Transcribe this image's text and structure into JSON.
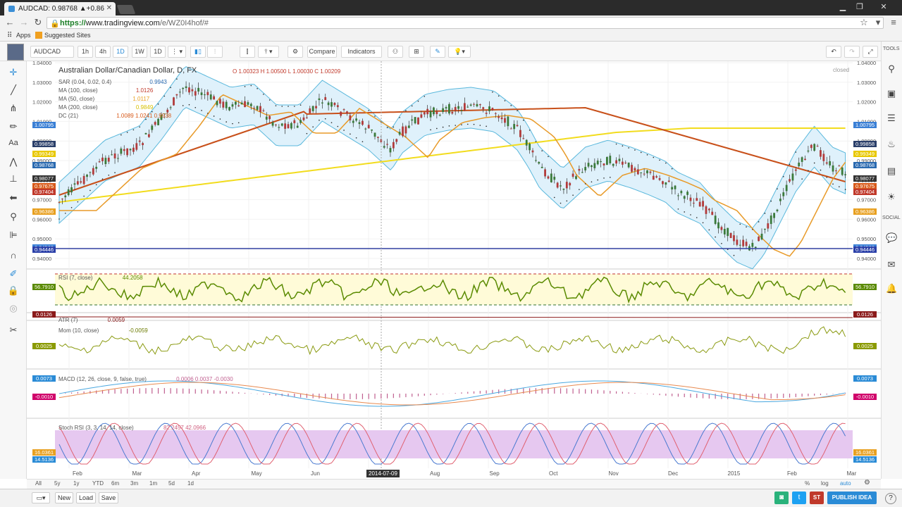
{
  "browser": {
    "tab_title": "AUDCAD: 0.98768 ▲+0.86",
    "url_prefix": "https://",
    "url_host": "www.tradingview.com",
    "url_path": "/e/WZ0I4hof/#",
    "bookmarks": [
      "Apps",
      "Suggested Sites"
    ]
  },
  "header": {
    "symbol": "AUDCAD",
    "intervals": [
      "1h",
      "4h",
      "1D",
      "1W",
      "1D"
    ],
    "compare_label": "Compare",
    "indicators_label": "Indicators"
  },
  "chart": {
    "title": "Australian Dollar/Canadian Dollar, D, FX",
    "ohlc": "O 1.00323 H 1.00500 L 1.00030 C 1.00209",
    "status": "closed",
    "studies": [
      {
        "name": "SAR (0.04, 0.02, 0.4)",
        "value": "0.9943"
      },
      {
        "name": "MA (100, close)",
        "value": "1.0126"
      },
      {
        "name": "MA (50, close)",
        "value": "1.0117"
      },
      {
        "name": "MA (200, close)",
        "value": "0.9849"
      },
      {
        "name": "DC (21)",
        "value": "1.0089  1.0241  0.9938"
      }
    ],
    "price_axis": [
      "1.04000",
      "1.03000",
      "1.02000",
      "1.01000",
      "1.00000",
      "0.99000",
      "0.98000",
      "0.97000",
      "0.96000",
      "0.95000",
      "0.94000"
    ],
    "price_tags": [
      {
        "value": "1.00795",
        "color": "#3a7fd5"
      },
      {
        "value": "0.99858",
        "color": "#2a3f6a"
      },
      {
        "value": "0.99349",
        "color": "#e8c800"
      },
      {
        "value": "0.98768",
        "color": "#2a6ab0"
      },
      {
        "value": "0.98077",
        "color": "#333"
      },
      {
        "value": "0.97675",
        "color": "#d85a1a"
      },
      {
        "value": "0.97404",
        "color": "#c0392b"
      },
      {
        "value": "0.96386",
        "color": "#e8a020"
      },
      {
        "value": "0.94560",
        "color": "#3a7fd5"
      },
      {
        "value": "0.94446",
        "color": "#2a3fa8"
      }
    ],
    "months": [
      "Feb",
      "Mar",
      "Apr",
      "May",
      "Jun",
      "Jul",
      "Aug",
      "Sep",
      "Oct",
      "Nov",
      "Dec",
      "2015",
      "Feb",
      "Mar"
    ],
    "cursor_date": "2014-07-09"
  },
  "panes": {
    "rsi": {
      "label": "RSI (7, close)",
      "value": "44.2058",
      "tag": "56.7910",
      "axis": [
        "80.0000",
        "40.0000"
      ]
    },
    "atr": {
      "label": "ATR (7)",
      "value": "0.0059",
      "tag": "0.0126"
    },
    "mom": {
      "label": "Mom (10, close)",
      "value": "-0.0059",
      "tag": "0.0025"
    },
    "macd": {
      "label": "MACD (12, 26, close, 9, false, true)",
      "values": "0.0006  0.0037  -0.0030",
      "tag_a": "0.0073",
      "tag_b": "-0.0010",
      "axis": [
        "-0.0100"
      ]
    },
    "stoch": {
      "label": "Stoch RSI (3, 3, 14, 14, close)",
      "values": "82.2457  42.0966",
      "tag_a": "16.0361",
      "tag_b": "14.5136",
      "axis": [
        "80.0000",
        "0.0000"
      ]
    }
  },
  "bottom": {
    "ranges": [
      "All",
      "5y",
      "1y",
      "YTD",
      "6m",
      "3m",
      "1m",
      "5d",
      "1d"
    ],
    "scale_opts": [
      "%",
      "log",
      "auto"
    ]
  },
  "footer": {
    "new_label": "New",
    "load_label": "Load",
    "save_label": "Save",
    "publish_label": "PUBLISH IDEA"
  },
  "sidebar_right": {
    "tools_label": "TOOLS",
    "social_label": "SOCIAL"
  }
}
